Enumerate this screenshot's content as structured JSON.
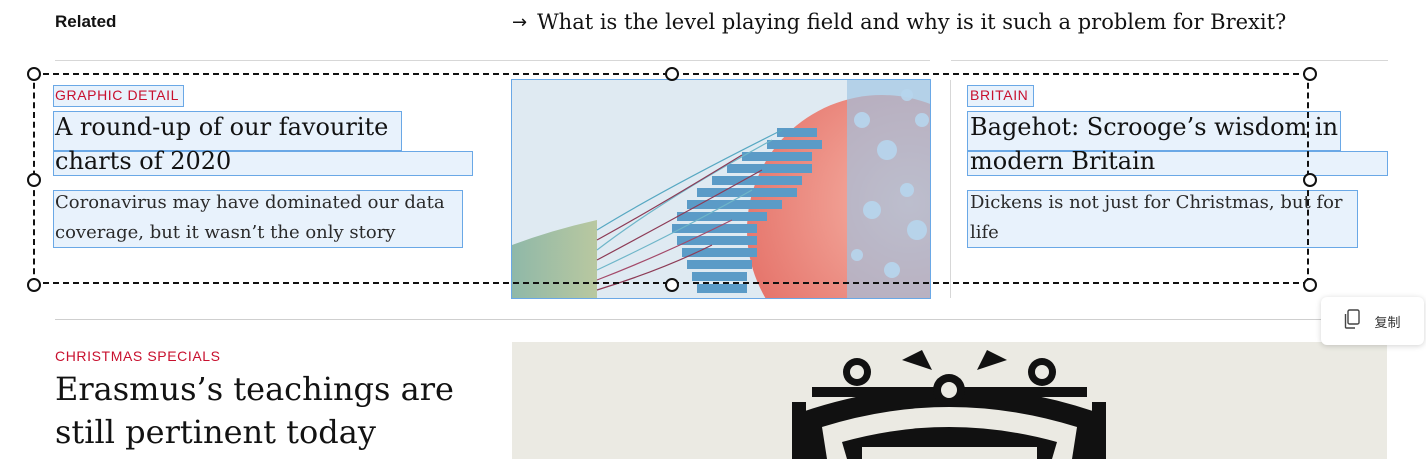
{
  "related": {
    "label": "Related",
    "link_arrow": "→",
    "link_text": "What is the level playing field and why is it such a problem for Brexit?"
  },
  "articles": [
    {
      "kicker": "GRAPHIC DETAIL",
      "headline_line1": "A round-up of our favourite",
      "headline_line2": "charts of 2020",
      "desc_line1": "Coronavirus may have dominated our data",
      "desc_line2": "coverage, but it wasn’t the only story"
    },
    {
      "kicker": "BRITAIN",
      "headline_line1": "Bagehot: Scrooge’s wisdom in",
      "headline_line2": "modern Britain",
      "desc_line1": "Dickens is not just for Christmas, but for",
      "desc_line2": "life"
    }
  ],
  "feature": {
    "kicker": "CHRISTMAS SPECIALS",
    "headline_line1": "Erasmus’s teachings are",
    "headline_line2": "still pertinent today"
  },
  "copy_popup": {
    "icon": "copy-icon",
    "label": "复制"
  },
  "colors": {
    "kicker_red": "#c8102e",
    "selection_blue": "#6aa8e6"
  }
}
